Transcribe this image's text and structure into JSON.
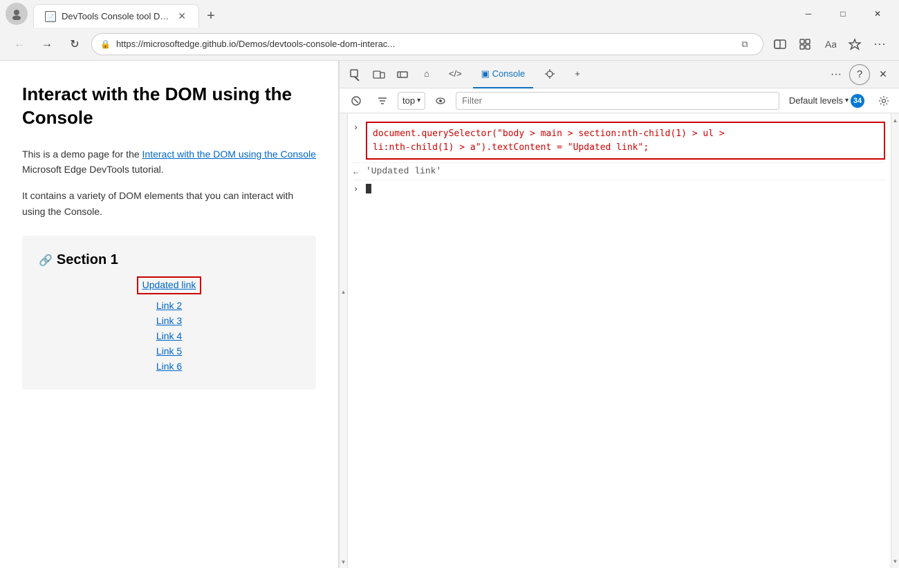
{
  "titleBar": {
    "tabTitle": "DevTools Console tool DOM inte",
    "newTabLabel": "+",
    "windowControls": {
      "minimize": "─",
      "maximize": "□",
      "close": "✕"
    }
  },
  "addressBar": {
    "url": "https://microsoftedge.github.io/Demos/devtools-console-dom-interac...",
    "backBtn": "←",
    "forwardBtn": "→",
    "refreshBtn": "↻"
  },
  "pageContent": {
    "heading": "Interact with the DOM using the Console",
    "para1prefix": "This is a demo page for the ",
    "para1link": "Interact with the DOM using the Console",
    "para1suffix": " Microsoft Edge DevTools tutorial.",
    "para2": "It contains a variety of DOM elements that you can interact with using the Console.",
    "sectionHeading": "Section 1",
    "links": [
      "Updated link",
      "Link 2",
      "Link 3",
      "Link 4",
      "Link 5",
      "Link 6"
    ]
  },
  "devtools": {
    "tabs": [
      {
        "label": "Elements",
        "icon": "◻"
      },
      {
        "label": "⊘",
        "icon": ""
      },
      {
        "label": "□",
        "icon": ""
      },
      {
        "label": "⌂",
        "icon": ""
      },
      {
        "label": "</>",
        "icon": ""
      },
      {
        "label": "Console",
        "icon": "▣",
        "active": true
      },
      {
        "label": "✱",
        "icon": ""
      },
      {
        "label": "+",
        "icon": ""
      }
    ],
    "consoleToolbar": {
      "clearBtn": "⊘",
      "topDropdown": "top",
      "eyeBtn": "◉",
      "filterPlaceholder": "Filter",
      "defaultLevels": "Default levels",
      "levelsCount": "34",
      "settingsIcon": "⚙"
    },
    "consoleEntries": [
      {
        "type": "input",
        "chevron": ">",
        "code": "document.querySelector(\"body > main > section:nth-child(1) > ul >\nli:nth-child(1) > a\").textContent = \"Updated link\";"
      },
      {
        "type": "result",
        "chevron": "←",
        "text": "'Updated link'"
      }
    ]
  }
}
